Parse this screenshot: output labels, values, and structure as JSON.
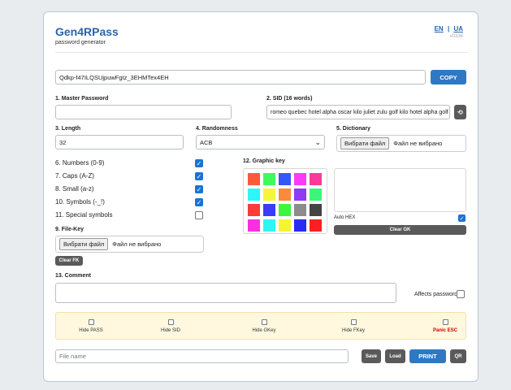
{
  "app": {
    "title": "Gen4RPass",
    "subtitle": "password generator",
    "lang_en": "EN",
    "lang_sep": "|",
    "lang_ua": "UA",
    "version": "v0336"
  },
  "password": {
    "value": "Qdkp-f47ILQSUjpuwFgtz_3EHMTex4EH",
    "copy_label": "COPY"
  },
  "master": {
    "label": "1. Master Password",
    "value": ""
  },
  "sid": {
    "label": "2. SID (16 words)",
    "value": "romeo quebec hotel alpha oscar kilo juliet zulu golf kilo hotel alpha golf",
    "refresh_label": "⟲"
  },
  "length": {
    "label": "3. Length",
    "value": "32"
  },
  "randomness": {
    "label": "4. Randomness",
    "selected": "ACB"
  },
  "dictionary": {
    "label": "5. Dictionary",
    "button": "Вибрати файл",
    "status": "Файл не вибрано"
  },
  "options": [
    {
      "label": "6. Numbers (0-9)",
      "checked": true
    },
    {
      "label": "7. Caps (A-Z)",
      "checked": true
    },
    {
      "label": "8. Small (a-z)",
      "checked": true
    },
    {
      "label": "10. Symbols (-_!)",
      "checked": true
    },
    {
      "label": "11. Special symbols",
      "checked": false
    }
  ],
  "graphic_key": {
    "label": "12. Graphic key",
    "colors": [
      "#fb5a3c",
      "#3dfb5d",
      "#3556fb",
      "#fb3bfb",
      "#fb3a9b",
      "#2ff5f5",
      "#f5f53a",
      "#fb8a3a",
      "#8e3bf5",
      "#3df57a",
      "#fb3a3a",
      "#3b3bfb",
      "#3df53d",
      "#8c8c8c",
      "#444444",
      "#fb2fe1",
      "#2ff5f5",
      "#f5f52f",
      "#2a2af5",
      "#fb2020"
    ],
    "auto_hex_label": "Auto HEX",
    "auto_hex_checked": true,
    "clear_label": "Clear GK"
  },
  "file_key": {
    "label": "9. File-Key",
    "button": "Вибрати файл",
    "status": "Файл не вибрано",
    "clear_label": "Clear FK"
  },
  "comment": {
    "label": "13. Comment",
    "value": "",
    "affects_label": "Affects password",
    "affects_checked": false
  },
  "hide_options": [
    {
      "label": "Hide PASS",
      "panic": false
    },
    {
      "label": "Hide SID",
      "panic": false
    },
    {
      "label": "Hide GKey",
      "panic": false
    },
    {
      "label": "Hide FKey",
      "panic": false
    },
    {
      "label": "Panic ESC",
      "panic": true
    }
  ],
  "footer": {
    "filename_placeholder": "File name",
    "save_label": "Save",
    "load_label": "Load",
    "print_label": "PRINT",
    "qr_label": "QR"
  },
  "colors": {
    "accent": "#2f78c2",
    "brand": "#2a64a8",
    "panic": "#cc0000"
  }
}
